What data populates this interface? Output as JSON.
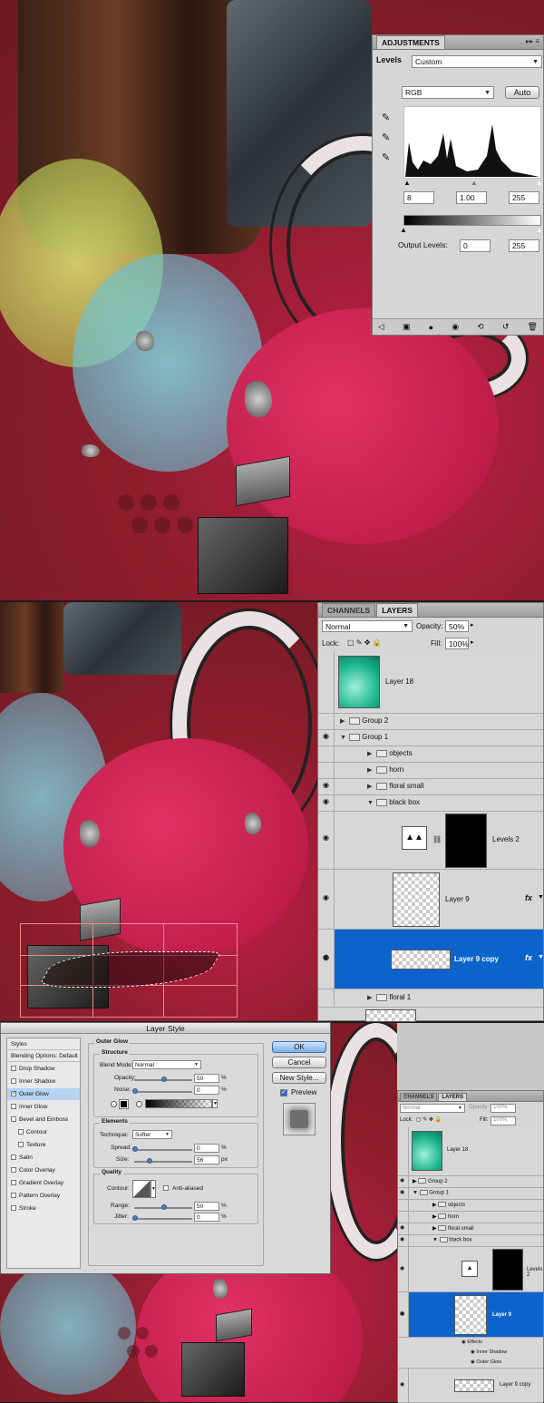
{
  "adjustments": {
    "tab": "ADJUSTMENTS",
    "preset_label": "Levels",
    "preset_value": "Custom",
    "channel": "RGB",
    "auto_button": "Auto",
    "input_black": "8",
    "input_gamma": "1.00",
    "input_white": "255",
    "output_label": "Output Levels:",
    "output_black": "0",
    "output_white": "255"
  },
  "layers": {
    "tabs": [
      "CHANNELS",
      "LAYERS"
    ],
    "blend_mode": "Normal",
    "opacity_label": "Opacity:",
    "opacity_value": "50%",
    "lock_label": "Lock:",
    "fill_label": "Fill:",
    "fill_value": "100%",
    "rows": {
      "layer18": "Layer 18",
      "group2": "Group 2",
      "group1": "Group 1",
      "objects": "objects",
      "horn": "horn",
      "floral_small": "floral small",
      "black_box": "black box",
      "levels2": "Levels 2",
      "layer9": "Layer 9",
      "layer9copy": "Layer 9 copy",
      "floral1": "floral 1"
    }
  },
  "layer_style": {
    "title": "Layer Style",
    "styles_header": "Styles",
    "blending_options": "Blending Options: Default",
    "style_items": [
      "Drop Shadow",
      "Inner Shadow",
      "Outer Glow",
      "Inner Glow",
      "Bevel and Emboss",
      "Contour",
      "Texture",
      "Satin",
      "Color Overlay",
      "Gradient Overlay",
      "Pattern Overlay",
      "Stroke"
    ],
    "section_title": "Outer Glow",
    "structure_title": "Structure",
    "blend_mode_label": "Blend Mode:",
    "blend_mode_value": "Normal",
    "opacity_label": "Opacity:",
    "opacity_value": "50",
    "noise_label": "Noise:",
    "noise_value": "0",
    "percent": "%",
    "elements_title": "Elements",
    "technique_label": "Technique:",
    "technique_value": "Softer",
    "spread_label": "Spread:",
    "spread_value": "0",
    "size_label": "Size:",
    "size_value": "56",
    "px": "px",
    "quality_title": "Quality",
    "contour_label": "Contour:",
    "anti_aliased": "Anti-aliased",
    "range_label": "Range:",
    "range_value": "50",
    "jitter_label": "Jitter:",
    "jitter_value": "0",
    "ok_button": "OK",
    "cancel_button": "Cancel",
    "new_style_button": "New Style...",
    "preview_label": "Preview"
  },
  "layers_small": {
    "tabs": [
      "CHANNELS",
      "LAYERS"
    ],
    "blend_mode": "Normal",
    "opacity_label": "Opacity:",
    "opacity_value": "100%",
    "lock_label": "Lock:",
    "fill_label": "Fill:",
    "fill_value": "100%",
    "rows": {
      "layer18": "Layer 18",
      "group2": "Group 2",
      "group1": "Group 1",
      "objects": "objects",
      "horn": "horn",
      "floral_small": "floral small",
      "black_box": "black box",
      "levels2": "Levels 2",
      "layer9": "Layer 9",
      "effects": "Effects",
      "inner_shadow": "Inner Shadow",
      "outer_glow": "Outer Glow",
      "layer9copy": "Layer 9 copy"
    }
  },
  "colors": {
    "selection_blue": "#0a64cc",
    "panel_gray": "#d6d6d6",
    "canvas_red": "#8e1d2c",
    "teal_thumb": "#1bb58f"
  }
}
